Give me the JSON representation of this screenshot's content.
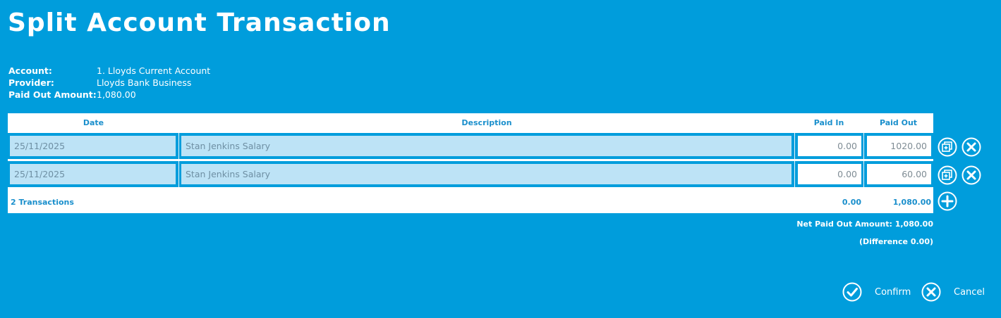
{
  "page": {
    "title": "Split Account Transaction"
  },
  "info": {
    "account_label": "Account:",
    "account_value": "1. Lloyds Current Account",
    "provider_label": "Provider:",
    "provider_value": "Lloyds Bank Business",
    "paid_out_label": "Paid Out Amount:",
    "paid_out_value": "1,080.00"
  },
  "table": {
    "headers": {
      "date": "Date",
      "description": "Description",
      "paid_in": "Paid In",
      "paid_out": "Paid Out"
    },
    "rows": [
      {
        "date": "25/11/2025",
        "description": "Stan Jenkins Salary",
        "paid_in": "0.00",
        "paid_out": "1020.00"
      },
      {
        "date": "25/11/2025",
        "description": "Stan Jenkins Salary",
        "paid_in": "0.00",
        "paid_out": "60.00"
      }
    ],
    "footer": {
      "count": "2 Transactions",
      "paid_in_total": "0.00",
      "paid_out_total": "1,080.00"
    }
  },
  "summary": {
    "net_paid_out": "Net Paid Out Amount: 1,080.00",
    "difference": "(Difference 0.00)"
  },
  "actions": {
    "confirm": "Confirm",
    "cancel": "Cancel"
  },
  "icons": {
    "copy": "copy-icon",
    "remove": "close-circle-icon",
    "add": "plus-circle-icon",
    "confirm": "check-circle-icon",
    "cancel": "close-circle-icon"
  },
  "colors": {
    "background": "#009ddc",
    "header_text": "#1a8fcc",
    "readonly_cell": "#bde3f6"
  }
}
